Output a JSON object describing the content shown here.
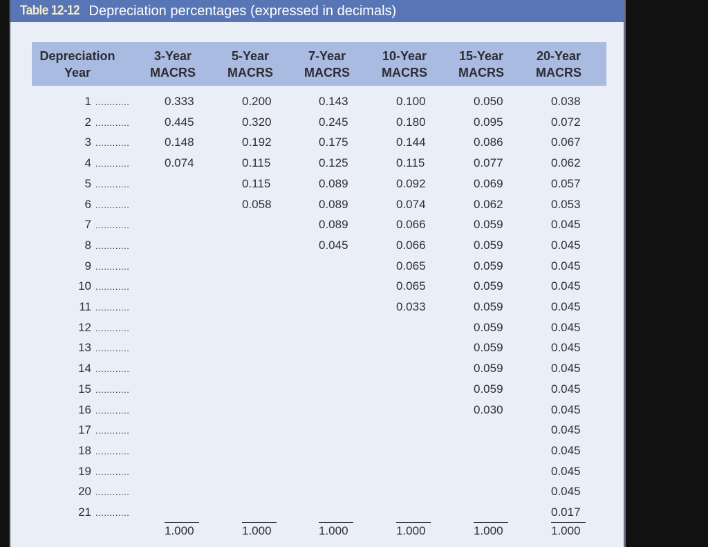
{
  "title": {
    "number": "Table 12-12",
    "text": "Depreciation percentages (expressed in decimals)"
  },
  "colors": {
    "title_bar": "#5876b5",
    "title_number": "#f3eccd",
    "header_band": "#a9bbe0",
    "background": "#eaeef7"
  },
  "headers": [
    {
      "line1": "Depreciation",
      "line2": "Year"
    },
    {
      "line1": "3-Year",
      "line2": "MACRS"
    },
    {
      "line1": "5-Year",
      "line2": "MACRS"
    },
    {
      "line1": "7-Year",
      "line2": "MACRS"
    },
    {
      "line1": "10-Year",
      "line2": "MACRS"
    },
    {
      "line1": "15-Year",
      "line2": "MACRS"
    },
    {
      "line1": "20-Year",
      "line2": "MACRS"
    }
  ],
  "leader_dots": "............",
  "years": [
    "1",
    "2",
    "3",
    "4",
    "5",
    "6",
    "7",
    "8",
    "9",
    "10",
    "11",
    "12",
    "13",
    "14",
    "15",
    "16",
    "17",
    "18",
    "19",
    "20",
    "21"
  ],
  "columns": [
    {
      "name": "3-Year MACRS",
      "values": [
        "0.333",
        "0.445",
        "0.148",
        "0.074"
      ],
      "total": "1.000"
    },
    {
      "name": "5-Year MACRS",
      "values": [
        "0.200",
        "0.320",
        "0.192",
        "0.115",
        "0.115",
        "0.058"
      ],
      "total": "1.000"
    },
    {
      "name": "7-Year MACRS",
      "values": [
        "0.143",
        "0.245",
        "0.175",
        "0.125",
        "0.089",
        "0.089",
        "0.089",
        "0.045"
      ],
      "total": "1.000"
    },
    {
      "name": "10-Year MACRS",
      "values": [
        "0.100",
        "0.180",
        "0.144",
        "0.115",
        "0.092",
        "0.074",
        "0.066",
        "0.066",
        "0.065",
        "0.065",
        "0.033"
      ],
      "total": "1.000"
    },
    {
      "name": "15-Year MACRS",
      "values": [
        "0.050",
        "0.095",
        "0.086",
        "0.077",
        "0.069",
        "0.062",
        "0.059",
        "0.059",
        "0.059",
        "0.059",
        "0.059",
        "0.059",
        "0.059",
        "0.059",
        "0.059",
        "0.030"
      ],
      "total": "1.000"
    },
    {
      "name": "20-Year MACRS",
      "values": [
        "0.038",
        "0.072",
        "0.067",
        "0.062",
        "0.057",
        "0.053",
        "0.045",
        "0.045",
        "0.045",
        "0.045",
        "0.045",
        "0.045",
        "0.045",
        "0.045",
        "0.045",
        "0.045",
        "0.045",
        "0.045",
        "0.045",
        "0.045",
        "0.017"
      ],
      "total": "1.000"
    }
  ]
}
